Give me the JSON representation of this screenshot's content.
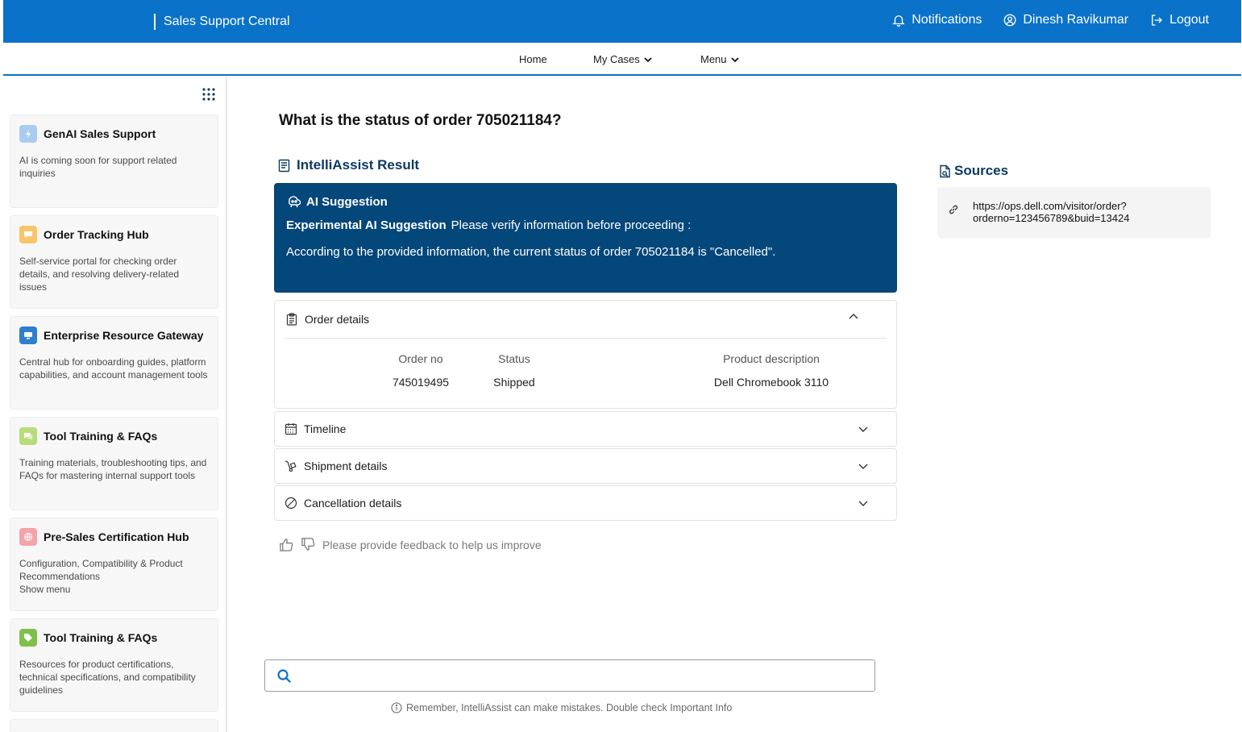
{
  "header": {
    "app_title": "Sales Support Central",
    "notifications": "Notifications",
    "user_name": "Dinesh Ravikumar",
    "logout": "Logout"
  },
  "nav": {
    "home": "Home",
    "my_cases": "My Cases",
    "menu": "Menu"
  },
  "sidebar": {
    "cards": [
      {
        "title": "GenAI Sales Support",
        "desc": "AI is coming soon for support related inquiries",
        "icon": "lightning-icon",
        "color": "#a9cdf0"
      },
      {
        "title": "Order Tracking Hub",
        "desc": "Self-service portal for checking order details, and resolving delivery-related issues",
        "icon": "chat-icon",
        "color": "#f7c66a"
      },
      {
        "title": "Enterprise Resource Gateway",
        "desc": "Central hub for onboarding guides, platform capabilities, and account management tools",
        "icon": "monitor-icon",
        "color": "#2f7fd0"
      },
      {
        "title": "Tool Training & FAQs",
        "desc": "Training materials, troubleshooting tips, and FAQs for mastering internal support tools",
        "icon": "message-icon",
        "color": "#b7dc7a"
      },
      {
        "title": "Pre-Sales Certification Hub",
        "desc": "Configuration, Compatibility & Product Recommendations\nShow menu",
        "icon": "globe-icon",
        "color": "#f4a3a8"
      },
      {
        "title": "Tool Training & FAQs",
        "desc": "Resources for product certifications, technical specifications, and compatibility guidelines",
        "icon": "tag-icon",
        "color": "#7fc04a"
      }
    ]
  },
  "main": {
    "question": "What is the status of order 705021184?",
    "result_title": "IntelliAssist Result",
    "ai": {
      "title": "AI Suggestion",
      "bold": "Experimental AI Suggestion",
      "note": "Please verify information before proceeding :",
      "answer": "According to the provided information, the current status of order 705021184 is \"Cancelled\"."
    },
    "order_details": {
      "title": "Order details",
      "headers": [
        "Order no",
        "Status",
        "Product description"
      ],
      "values": [
        "745019495",
        "Shipped",
        "Dell Chromebook 3110"
      ]
    },
    "timeline": "Timeline",
    "shipment": "Shipment details",
    "cancellation": "Cancellation details",
    "feedback": "Please provide feedback to help us improve"
  },
  "sources": {
    "title": "Sources",
    "url_line1": "https://ops.dell.com/visitor/order?",
    "url_line2": "orderno=123456789&buid=13424"
  },
  "search": {
    "placeholder": "",
    "disclaimer": "Remember, IntelliAssist can make mistakes. Double check Important Info"
  }
}
